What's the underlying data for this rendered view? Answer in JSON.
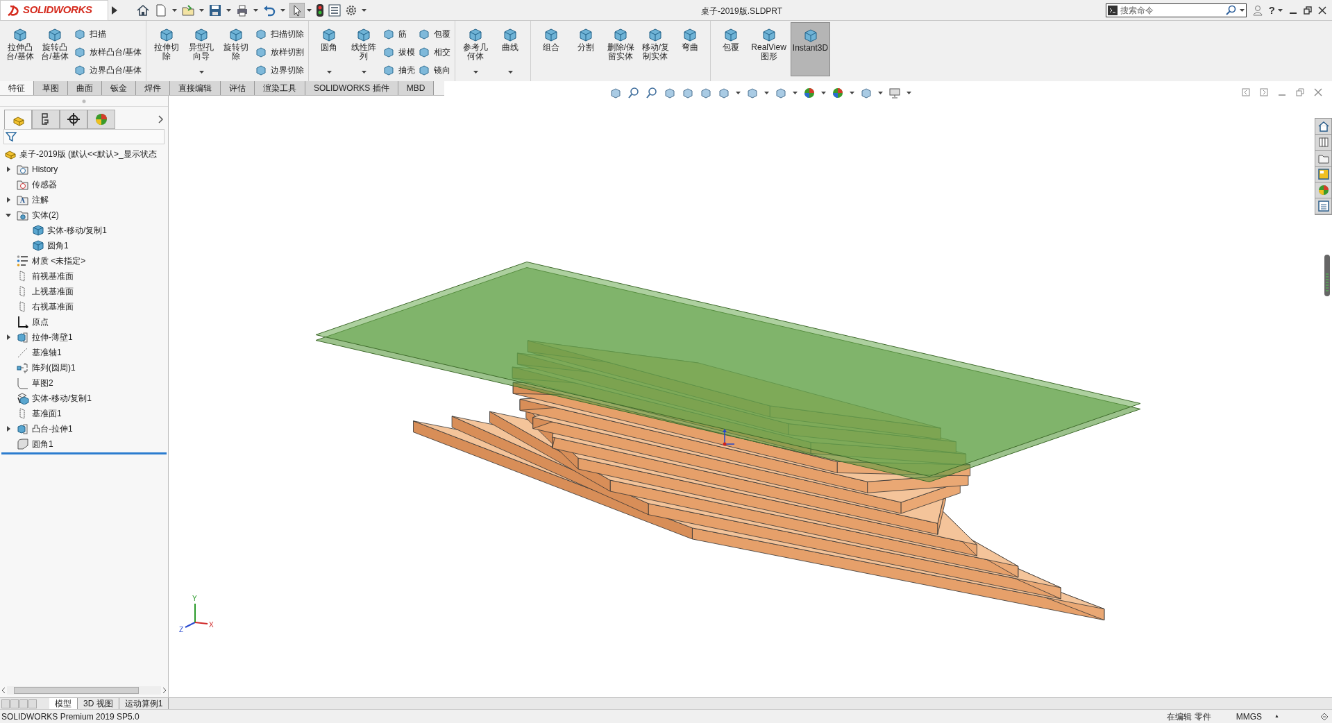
{
  "title_bar": {
    "logo": "SOLIDWORKS",
    "document_title": "桌子-2019版.SLDPRT",
    "search": {
      "placeholder": "搜索命令"
    },
    "help": "?"
  },
  "ribbon": {
    "groups": [
      {
        "columns": [
          {
            "kind": "large",
            "label": "拉伸凸台/基体",
            "dropdown": false,
            "on": false
          },
          {
            "kind": "large",
            "label": "旋转凸台/基体",
            "dropdown": false,
            "on": false
          },
          {
            "kind": "stack",
            "items": [
              "扫描",
              "放样凸台/基体",
              "边界凸台/基体"
            ]
          }
        ]
      },
      {
        "columns": [
          {
            "kind": "large",
            "label": "拉伸切除",
            "dropdown": false,
            "on": false
          },
          {
            "kind": "large",
            "label": "异型孔向导",
            "dropdown": true,
            "on": false
          },
          {
            "kind": "large",
            "label": "旋转切除",
            "dropdown": false,
            "on": false
          },
          {
            "kind": "stack",
            "items": [
              "扫描切除",
              "放样切割",
              "边界切除"
            ]
          }
        ]
      },
      {
        "columns": [
          {
            "kind": "large",
            "label": "圆角",
            "dropdown": true,
            "on": false
          },
          {
            "kind": "large",
            "label": "线性阵列",
            "dropdown": true,
            "on": false
          },
          {
            "kind": "stack",
            "items": [
              "筋",
              "拔模",
              "抽壳"
            ]
          },
          {
            "kind": "stack",
            "items": [
              "包覆",
              "相交",
              "镜向"
            ]
          }
        ]
      },
      {
        "columns": [
          {
            "kind": "large",
            "label": "参考几何体",
            "dropdown": true,
            "on": false
          },
          {
            "kind": "large",
            "label": "曲线",
            "dropdown": true,
            "on": false
          }
        ]
      },
      {
        "columns": [
          {
            "kind": "large",
            "label": "组合",
            "dropdown": false,
            "on": false
          },
          {
            "kind": "large",
            "label": "分割",
            "dropdown": false,
            "on": false
          },
          {
            "kind": "large",
            "label": "删除/保留实体",
            "dropdown": false,
            "on": false
          },
          {
            "kind": "large",
            "label": "移动/复制实体",
            "dropdown": false,
            "on": false
          },
          {
            "kind": "large",
            "label": "弯曲",
            "dropdown": false,
            "on": false
          }
        ]
      },
      {
        "columns": [
          {
            "kind": "large",
            "label": "包覆",
            "dropdown": false,
            "on": false
          },
          {
            "kind": "large",
            "label": "RealView图形",
            "dropdown": false,
            "on": false
          },
          {
            "kind": "large",
            "label": "Instant3D",
            "dropdown": false,
            "on": true
          }
        ]
      }
    ]
  },
  "tabs": [
    {
      "label": "特征",
      "selected": true
    },
    {
      "label": "草图",
      "selected": false
    },
    {
      "label": "曲面",
      "selected": false
    },
    {
      "label": "钣金",
      "selected": false
    },
    {
      "label": "焊件",
      "selected": false
    },
    {
      "label": "直接编辑",
      "selected": false
    },
    {
      "label": "评估",
      "selected": false
    },
    {
      "label": "渲染工具",
      "selected": false
    },
    {
      "label": "SOLIDWORKS 插件",
      "selected": false
    },
    {
      "label": "MBD",
      "selected": false
    }
  ],
  "feature_tree": {
    "root": "桌子-2019版  (默认<<默认>_显示状态",
    "items": [
      {
        "label": "History",
        "kind": "history",
        "expanded": false
      },
      {
        "label": "传感器",
        "kind": "sensor"
      },
      {
        "label": "注解",
        "kind": "annotation",
        "icon_text": "A",
        "expanded": false
      },
      {
        "label": "实体(2)",
        "kind": "bodies",
        "expanded": true,
        "children": [
          {
            "label": "实体-移动/复制1",
            "kind": "body"
          },
          {
            "label": "圆角1",
            "kind": "body"
          }
        ]
      },
      {
        "label": "材质 <未指定>",
        "kind": "material"
      },
      {
        "label": "前视基准面",
        "kind": "plane"
      },
      {
        "label": "上视基准面",
        "kind": "plane"
      },
      {
        "label": "右视基准面",
        "kind": "plane"
      },
      {
        "label": "原点",
        "kind": "origin"
      },
      {
        "label": "拉伸-薄壁1",
        "kind": "extrude",
        "expanded": false
      },
      {
        "label": "基准轴1",
        "kind": "axis"
      },
      {
        "label": "阵列(圆周)1",
        "kind": "pattern"
      },
      {
        "label": "草图2",
        "kind": "sketch"
      },
      {
        "label": "实体-移动/复制1",
        "kind": "move"
      },
      {
        "label": "基准面1",
        "kind": "plane"
      },
      {
        "label": "凸台-拉伸1",
        "kind": "extrude",
        "expanded": false
      },
      {
        "label": "圆角1",
        "kind": "fillet"
      }
    ]
  },
  "triad": {
    "x": "X",
    "y": "Y",
    "z": "Z"
  },
  "bottom_tabs": [
    {
      "label": "模型",
      "selected": true
    },
    {
      "label": "3D 视图",
      "selected": false
    },
    {
      "label": "运动算例1",
      "selected": false
    }
  ],
  "status_bar": {
    "version": "SOLIDWORKS Premium 2019 SP5.0",
    "mode": "在编辑 零件",
    "units": "MMGS",
    "units_caret": "▲"
  }
}
